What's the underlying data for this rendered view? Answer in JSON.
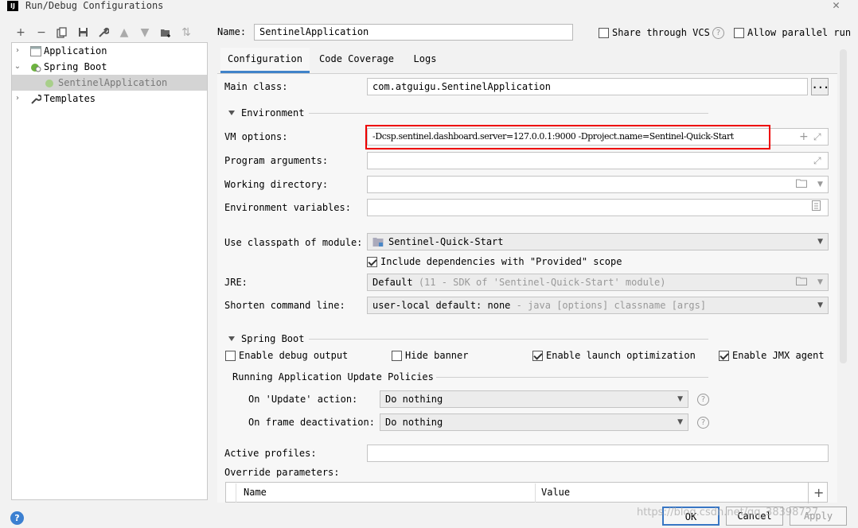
{
  "window": {
    "title": "Run/Debug Configurations",
    "logo": "IJ"
  },
  "toolbar": {
    "icons": [
      "plus-icon",
      "minus-icon",
      "copy-icon",
      "save-icon",
      "wrench-icon",
      "arrow-up-icon",
      "arrow-down-icon",
      "folder-add-icon",
      "sort-icon"
    ]
  },
  "tree": {
    "items": [
      {
        "label": "Application"
      },
      {
        "label": "Spring Boot"
      },
      {
        "label": "SentinelApplication"
      },
      {
        "label": "Templates"
      }
    ]
  },
  "header": {
    "name_label": "Name:",
    "name_value": "SentinelApplication",
    "share_vcs": "Share through VCS",
    "allow_parallel": "Allow parallel run"
  },
  "tabs": [
    {
      "label": "Configuration"
    },
    {
      "label": "Code Coverage"
    },
    {
      "label": "Logs"
    }
  ],
  "config": {
    "main_class_label": "Main class:",
    "main_class_value": "com.atguigu.SentinelApplication",
    "browse_label": "...",
    "environment_section": "Environment",
    "vm_options_label": "VM options:",
    "vm_options_value": "-Dcsp.sentinel.dashboard.server=127.0.0.1:9000 -Dproject.name=Sentinel-Quick-Start",
    "program_args_label": "Program arguments:",
    "working_dir_label": "Working directory:",
    "env_vars_label": "Environment variables:",
    "classpath_label": "Use classpath of module:",
    "classpath_value": "Sentinel-Quick-Start",
    "include_deps": "Include dependencies with \"Provided\" scope",
    "jre_label": "JRE:",
    "jre_value": "Default",
    "jre_hint": "(11 - SDK of 'Sentinel-Quick-Start' module)",
    "shorten_label": "Shorten command line:",
    "shorten_value": "user-local default: none",
    "shorten_hint": "- java [options] classname [args]",
    "spring_boot_section": "Spring Boot",
    "enable_debug": "Enable debug output",
    "hide_banner": "Hide banner",
    "enable_launch": "Enable launch optimization",
    "enable_jmx": "Enable JMX agent",
    "update_policies": "Running Application Update Policies",
    "on_update_label": "On 'Update' action:",
    "on_update_value": "Do nothing",
    "on_frame_label": "On frame deactivation:",
    "on_frame_value": "Do nothing",
    "active_profiles_label": "Active profiles:",
    "override_params_label": "Override parameters:",
    "table_col_name": "Name",
    "table_col_value": "Value",
    "help_glyph": "?"
  },
  "footer": {
    "help": "?",
    "ok": "OK",
    "cancel": "Cancel",
    "apply": "Apply",
    "watermark": "https://blog.csdn.net/qq_38398727"
  },
  "colors": {
    "accent": "#4083c9",
    "highlight": "#e00000",
    "ok_border": "#3876c4"
  }
}
